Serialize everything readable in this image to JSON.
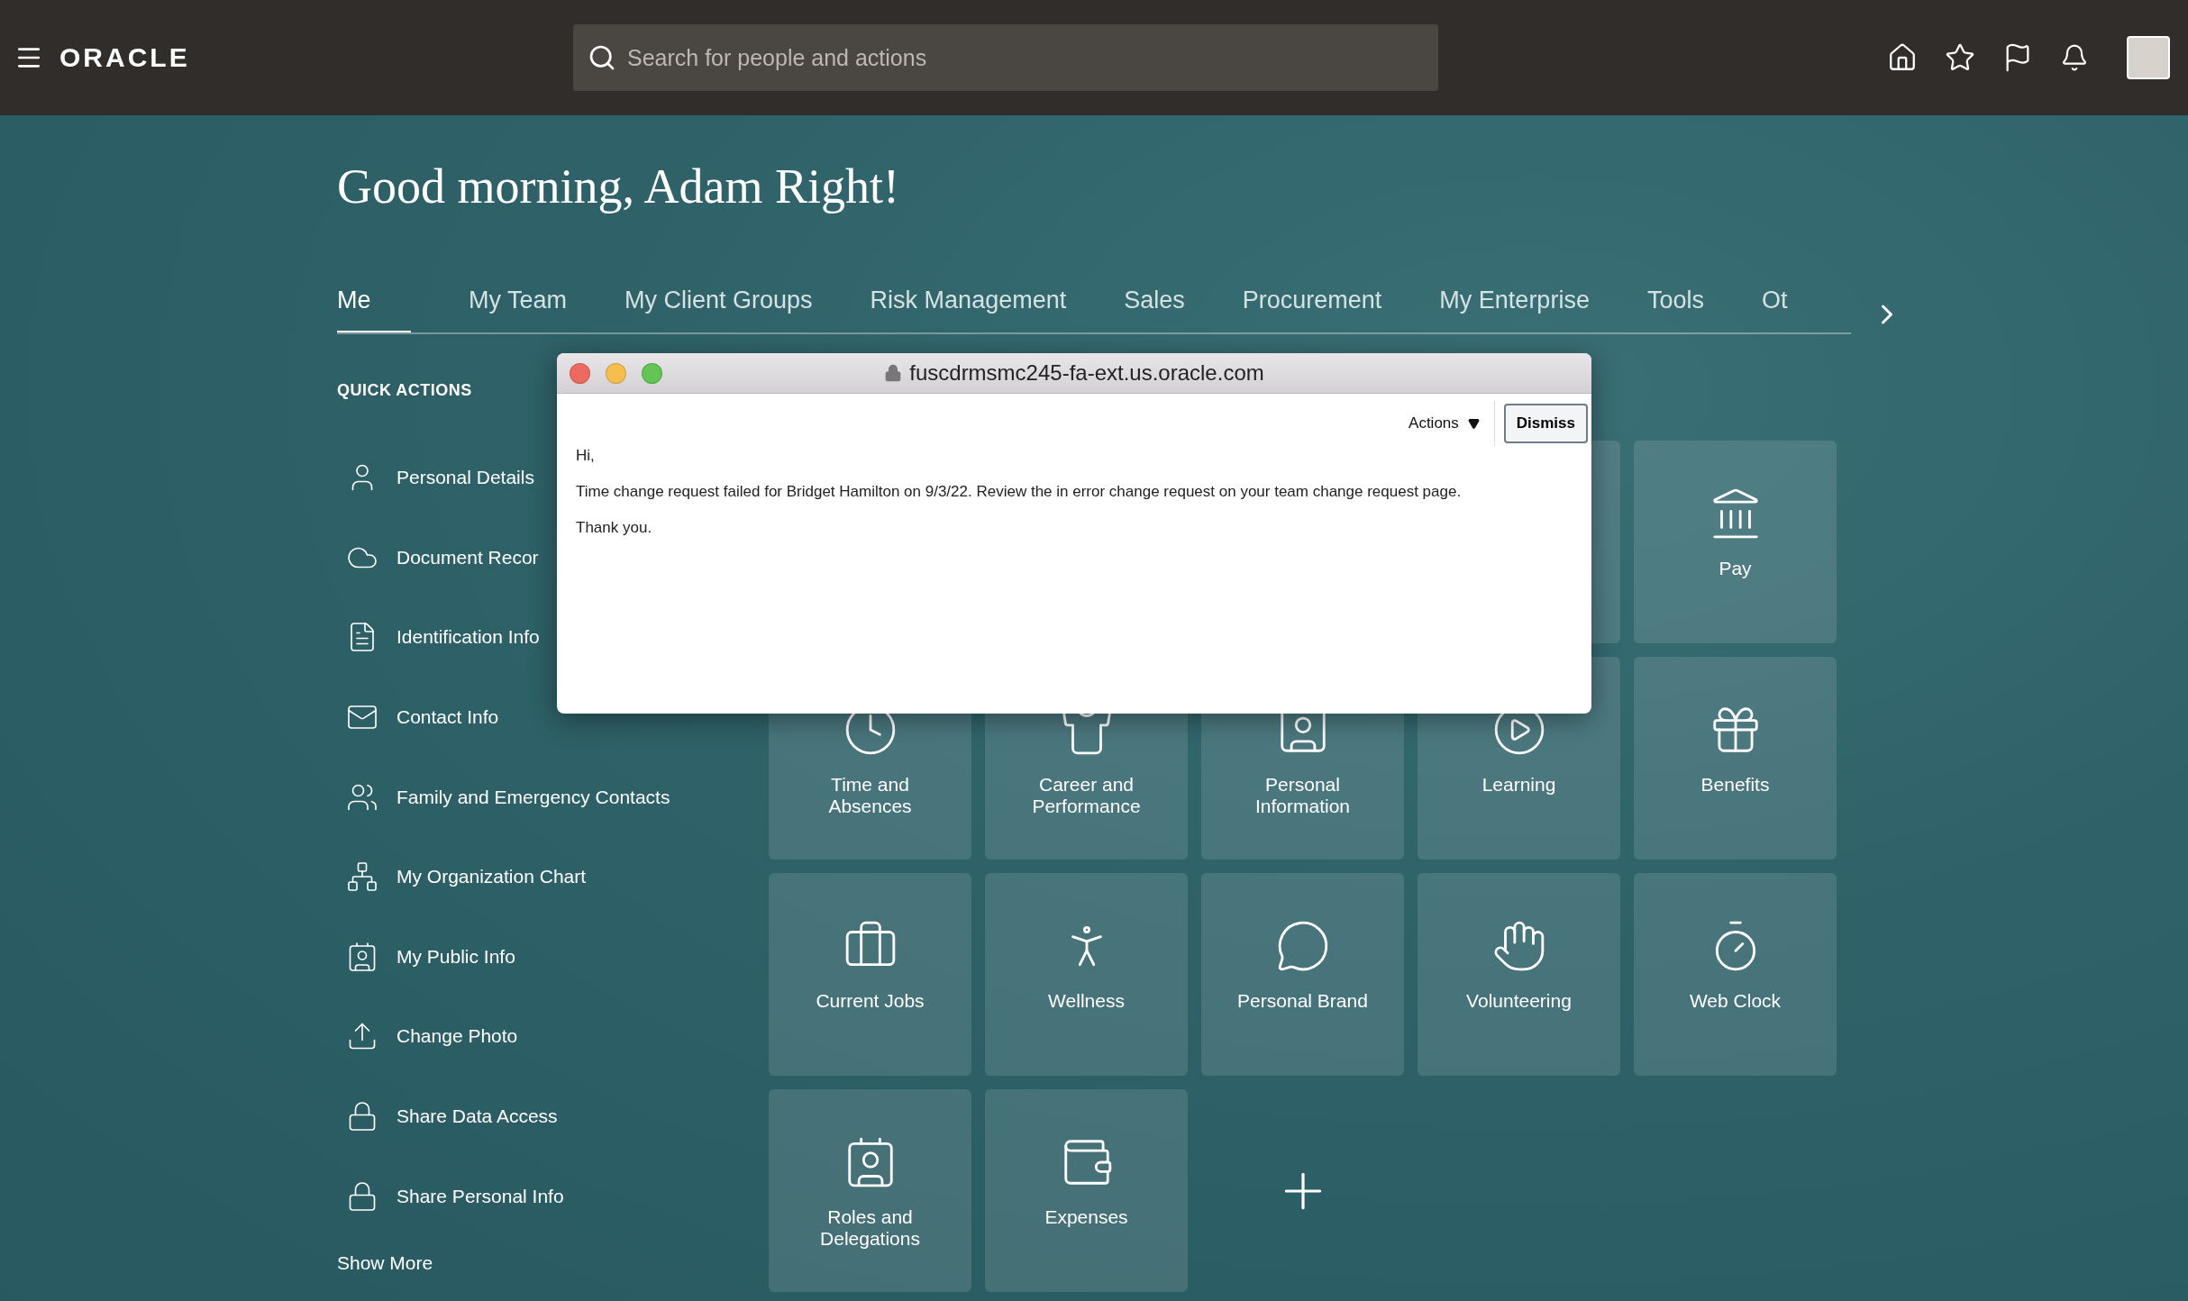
{
  "header": {
    "logo": "ORACLE",
    "search": {
      "placeholder": "Search for people and actions"
    }
  },
  "greeting": "Good morning, Adam Right!",
  "tabs": [
    {
      "label": "Me",
      "selected": true
    },
    {
      "label": "My Team",
      "selected": false
    },
    {
      "label": "My Client Groups",
      "selected": false
    },
    {
      "label": "Risk Management",
      "selected": false
    },
    {
      "label": "Sales",
      "selected": false
    },
    {
      "label": "Procurement",
      "selected": false
    },
    {
      "label": "My Enterprise",
      "selected": false
    },
    {
      "label": "Tools",
      "selected": false
    },
    {
      "label": "Ot",
      "selected": false
    }
  ],
  "quick_actions": {
    "title": "QUICK ACTIONS",
    "items": [
      "Personal Details",
      "Document Recor",
      "Identification Info",
      "Contact Info",
      "Family and Emergency Contacts",
      "My Organization Chart",
      "My Public Info",
      "Change Photo",
      "Share Data Access",
      "Share Personal Info"
    ],
    "show_more": "Show More"
  },
  "tiles": [
    {
      "label": "Pay",
      "kind": "pay"
    },
    {
      "label": "Time and Absences",
      "kind": "time"
    },
    {
      "label": "Career and Performance",
      "kind": "career"
    },
    {
      "label": "Personal Information",
      "kind": "personal"
    },
    {
      "label": "Learning",
      "kind": "learning"
    },
    {
      "label": "Benefits",
      "kind": "benefits"
    },
    {
      "label": "Current Jobs",
      "kind": "jobs"
    },
    {
      "label": "Wellness",
      "kind": "wellness"
    },
    {
      "label": "Personal Brand",
      "kind": "brand"
    },
    {
      "label": "Volunteering",
      "kind": "volunteering"
    },
    {
      "label": "Web Clock",
      "kind": "clock"
    },
    {
      "label": "Roles and Delegations",
      "kind": "roles"
    },
    {
      "label": "Expenses",
      "kind": "expenses"
    },
    {
      "kind": "add"
    }
  ],
  "popup": {
    "url": "fuscdrmsmc245-fa-ext.us.oracle.com",
    "actions": "Actions",
    "dismiss": "Dismiss",
    "lines": [
      "Hi,",
      "Time change request failed for Bridget Hamilton on 9/3/22. Review the in error change request on your team change request page.",
      "Thank you."
    ]
  }
}
